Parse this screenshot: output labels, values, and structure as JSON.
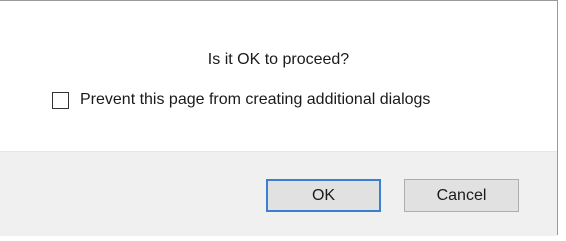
{
  "dialog": {
    "message": "Is it OK to proceed?",
    "checkbox_label": "Prevent this page from creating additional dialogs",
    "checkbox_checked": false
  },
  "buttons": {
    "ok_label": "OK",
    "cancel_label": "Cancel"
  },
  "colors": {
    "footer_background": "#f0f0f0",
    "focused_button_border": "#3c7fd1",
    "button_background": "#e1e1e1"
  }
}
